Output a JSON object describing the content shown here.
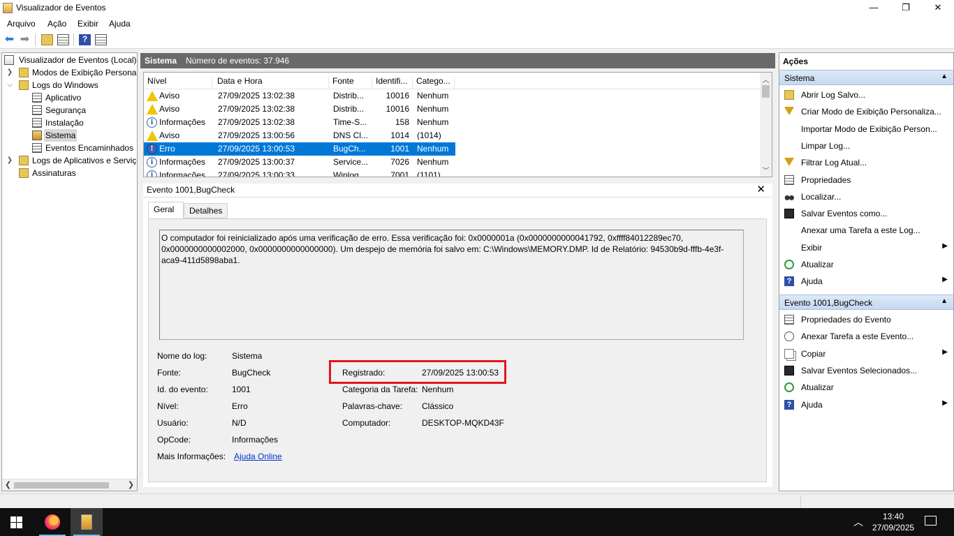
{
  "window": {
    "title": "Visualizador de Eventos",
    "minimize": "—",
    "maximize": "❐",
    "close": "✕"
  },
  "menu": [
    "Arquivo",
    "Ação",
    "Exibir",
    "Ajuda"
  ],
  "tree": {
    "root": "Visualizador de Eventos (Local)",
    "custom_views": "Modos de Exibição Personalizados",
    "windows_logs": "Logs do Windows",
    "app": "Aplicativo",
    "security": "Segurança",
    "setup": "Instalação",
    "system": "Sistema",
    "forwarded": "Eventos Encaminhados",
    "app_services": "Logs de Aplicativos e Serviços",
    "subscriptions": "Assinaturas"
  },
  "center": {
    "log_name": "Sistema",
    "event_count": "Número de eventos: 37.946"
  },
  "events": {
    "columns": [
      "Nível",
      "Data e Hora",
      "Fonte",
      "Identifi...",
      "Catego..."
    ],
    "rows": [
      {
        "level": "Aviso",
        "icon": "warning",
        "datetime": "27/09/2025 13:02:38",
        "source": "Distrib...",
        "id": "10016",
        "category": "Nenhum"
      },
      {
        "level": "Aviso",
        "icon": "warning",
        "datetime": "27/09/2025 13:02:38",
        "source": "Distrib...",
        "id": "10016",
        "category": "Nenhum"
      },
      {
        "level": "Informações",
        "icon": "info",
        "datetime": "27/09/2025 13:02:38",
        "source": "Time-S...",
        "id": "158",
        "category": "Nenhum"
      },
      {
        "level": "Aviso",
        "icon": "warning",
        "datetime": "27/09/2025 13:00:56",
        "source": "DNS Cl...",
        "id": "1014",
        "category": "(1014)"
      },
      {
        "level": "Erro",
        "icon": "error",
        "datetime": "27/09/2025 13:00:53",
        "source": "BugCh...",
        "id": "1001",
        "category": "Nenhum"
      },
      {
        "level": "Informações",
        "icon": "info",
        "datetime": "27/09/2025 13:00:37",
        "source": "Service...",
        "id": "7026",
        "category": "Nenhum"
      },
      {
        "level": "Informações",
        "icon": "info",
        "datetime": "27/09/2025 13:00:33",
        "source": "Winlog...",
        "id": "7001",
        "category": "(1101)"
      }
    ]
  },
  "detail": {
    "header": "Evento 1001,BugCheck",
    "tab_general": "Geral",
    "tab_details": "Detalhes",
    "description": "O computador foi reinicializado após uma verificação de erro. Essa verificação foi: 0x0000001a (0x0000000000041792, 0xffff84012289ec70, 0x0000000000002000, 0x0000000000000000). Um despejo de memória foi salvo em: C:\\Windows\\MEMORY.DMP. Id de Relatório: 94530b9d-fffb-4e3f-aca9-411d5898aba1.",
    "labels": {
      "log_name": "Nome do log:",
      "source": "Fonte:",
      "event_id": "Id. do evento:",
      "level": "Nível:",
      "user": "Usuário:",
      "opcode": "OpCode:",
      "more_info": "Mais Informações:",
      "logged": "Registrado:",
      "task_category": "Categoria da Tarefa:",
      "keywords": "Palavras-chave:",
      "computer": "Computador:"
    },
    "values": {
      "log_name": "Sistema",
      "source": "BugCheck",
      "event_id": "1001",
      "level": "Erro",
      "user": "N/D",
      "opcode": "Informações",
      "more_info": "Ajuda Online",
      "logged": "27/09/2025 13:00:53",
      "task_category": "Nenhum",
      "keywords": "Clássico",
      "computer": "DESKTOP-MQKD43F"
    },
    "highlight_color": "#e5141c"
  },
  "actions": {
    "title": "Ações",
    "section1": "Sistema",
    "items1": [
      {
        "label": "Abrir Log Salvo...",
        "icon": "folder"
      },
      {
        "label": "Criar Modo de Exibição Personaliza...",
        "icon": "filter"
      },
      {
        "label": "Importar Modo de Exibição Person...",
        "icon": ""
      },
      {
        "label": "Limpar Log...",
        "icon": ""
      },
      {
        "label": "Filtrar Log Atual...",
        "icon": "filter"
      },
      {
        "label": "Propriedades",
        "icon": "doc"
      },
      {
        "label": "Localizar...",
        "icon": "binoculars"
      },
      {
        "label": "Salvar Eventos como...",
        "icon": "save"
      },
      {
        "label": "Anexar uma Tarefa a este Log...",
        "icon": ""
      },
      {
        "label": "Exibir",
        "icon": "",
        "submenu": true
      },
      {
        "label": "Atualizar",
        "icon": "refresh"
      },
      {
        "label": "Ajuda",
        "icon": "help",
        "submenu": true
      }
    ],
    "section2": "Evento 1001,BugCheck",
    "items2": [
      {
        "label": "Propriedades do Evento",
        "icon": "doc"
      },
      {
        "label": "Anexar Tarefa a este Evento...",
        "icon": "clock"
      },
      {
        "label": "Copiar",
        "icon": "copy",
        "submenu": true
      },
      {
        "label": "Salvar Eventos Selecionados...",
        "icon": "save"
      },
      {
        "label": "Atualizar",
        "icon": "refresh"
      },
      {
        "label": "Ajuda",
        "icon": "help",
        "submenu": true
      }
    ]
  },
  "taskbar": {
    "time": "13:40",
    "date": "27/09/2025"
  },
  "colors": {
    "selection": "#0078d7",
    "header_bg": "#696969"
  }
}
